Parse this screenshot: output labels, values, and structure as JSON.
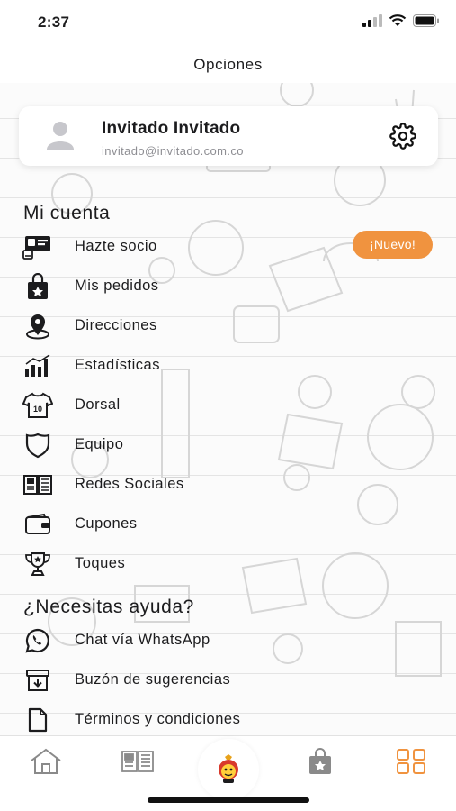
{
  "status_bar": {
    "time": "2:37"
  },
  "header": {
    "title": "Opciones"
  },
  "profile": {
    "name": "Invitado Invitado",
    "email": "invitado@invitado.com.co",
    "avatar_icon": "person-icon",
    "settings_icon": "gear-icon"
  },
  "account_section": {
    "title": "Mi cuenta",
    "badge": "¡Nuevo!",
    "items": [
      {
        "label": "Hazte socio",
        "icon": "member-card-icon"
      },
      {
        "label": "Mis pedidos",
        "icon": "shopping-bag-icon"
      },
      {
        "label": "Direcciones",
        "icon": "location-pin-icon"
      },
      {
        "label": "Estadísticas",
        "icon": "bar-chart-icon"
      },
      {
        "label": "Dorsal",
        "icon": "jersey-icon"
      },
      {
        "label": "Equipo",
        "icon": "shield-icon"
      },
      {
        "label": "Redes Sociales",
        "icon": "newspaper-icon"
      },
      {
        "label": "Cupones",
        "icon": "wallet-icon"
      },
      {
        "label": "Toques",
        "icon": "trophy-icon"
      }
    ]
  },
  "help_section": {
    "title": "¿Necesitas ayuda?",
    "items": [
      {
        "label": "Chat vía WhatsApp",
        "icon": "whatsapp-icon"
      },
      {
        "label": "Buzón de sugerencias",
        "icon": "inbox-icon"
      },
      {
        "label": "Términos y condiciones",
        "icon": "document-icon"
      }
    ]
  },
  "tab_bar": {
    "tabs": [
      {
        "icon": "home-icon"
      },
      {
        "icon": "news-icon"
      },
      {
        "icon": "club-logo-icon"
      },
      {
        "icon": "store-bag-icon"
      },
      {
        "icon": "grid-menu-icon"
      }
    ],
    "active_color": "#f0933f",
    "inactive_color": "#8a8a8a"
  },
  "colors": {
    "accent": "#f0933f",
    "text": "#1c1c1e",
    "muted": "#8e8e93"
  }
}
